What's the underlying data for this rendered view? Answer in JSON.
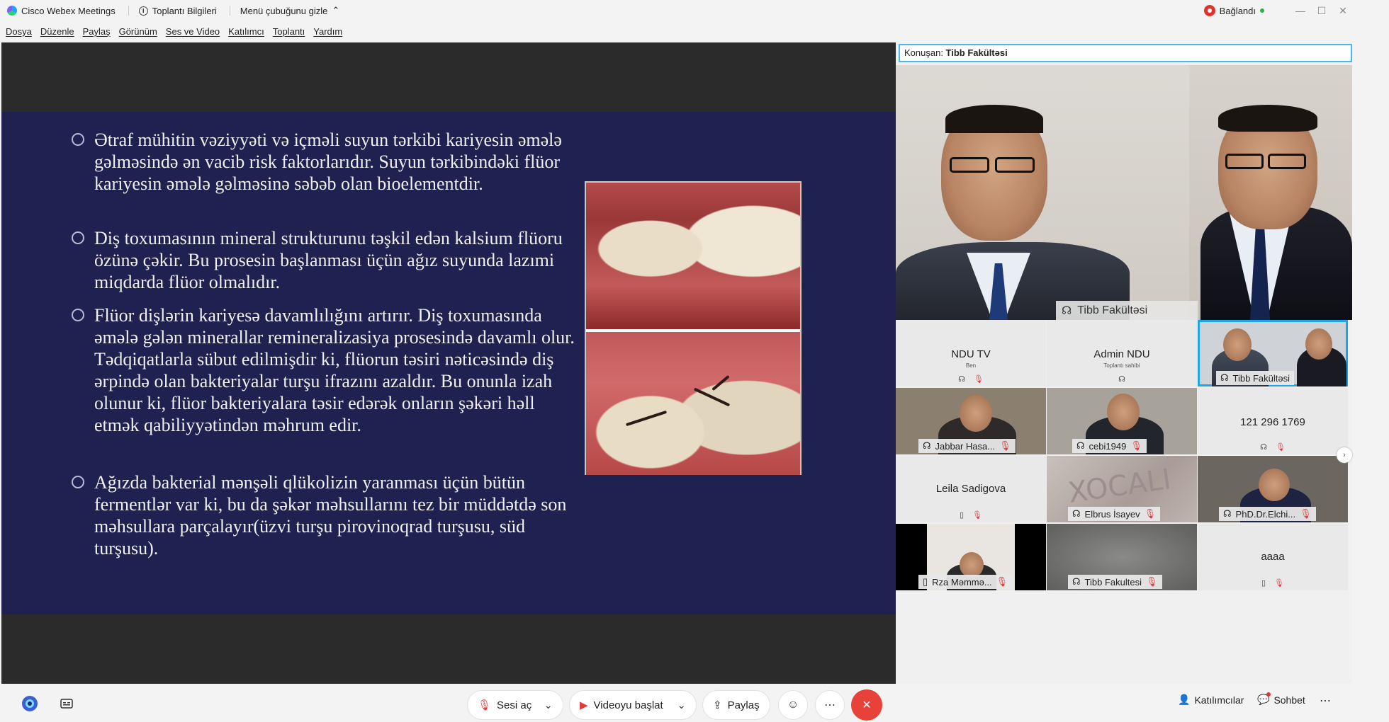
{
  "titlebar": {
    "app_name": "Cisco Webex Meetings",
    "meeting_info": "Toplantı Bilgileri",
    "hide_menu": "Menü çubuğunu gizle",
    "status": "Bağlandı"
  },
  "menu": [
    "Dosya",
    "Düzenle",
    "Paylaş",
    "Görünüm",
    "Ses ve Video",
    "Katılımcı",
    "Toplantı",
    "Yardım"
  ],
  "slide": {
    "bullets": [
      "Ətraf mühitin vəziyyəti və içməli suyun tərkibi  kariyesin əmələ gəlməsində  ən vacib risk faktorlarıdır. Suyun tərkibindəki flüor kariyesin əmələ gəlməsinə səbəb olan bioelementdir.",
      " Diş toxumasının mineral strukturunu təşkil edən kalsium flüoru özünə çəkir. Bu prosesin başlanması üçün ağız suyunda lazımi miqdarda flüor olmalıdır.",
      " Flüor dişlərin kariyesə davamlılığını artırır. Diş toxumasında əmələ gələn minerallar remineralizasiya prosesində davamlı olur. Tədqiqatlarla sübut edilmişdir ki, flüorun təsiri nəticəsində diş ərpində olan bakteriyalar turşu ifrazını azaldır. Bu onunla izah olunur ki, flüor bakteriyalara təsir edərək onların şəkəri həll etmək qabiliyyətindən məhrum edir.",
      "Ağızda bakterial mənşəli qlükolizin yaranması üçün bütün fermentlər var ki, bu da şəkər məhsullarını tez bir müddətdə son məhsullara parçalayır(üzvi  turşu pirovinoqrad turşusu, süd turşusu)."
    ]
  },
  "speaker": {
    "prefix": "Konuşan: ",
    "name": "Tibb Fakültəsi"
  },
  "main_video_label": "Tibb Fakültəsi",
  "participants": [
    {
      "name": "NDU TV",
      "sub": "Ben"
    },
    {
      "name": "Admin NDU",
      "sub": "Toplantı sahibi"
    },
    {
      "name": "Tibb Fakültəsi"
    },
    {
      "name": "Jabbar Hasa..."
    },
    {
      "name": "cebi1949"
    },
    {
      "name": "121 296 1769"
    },
    {
      "name": "Leila Sadigova"
    },
    {
      "name": "Elbrus İsayev"
    },
    {
      "name": "PhD.Dr.Elchi..."
    },
    {
      "name": "Rza Məmmə..."
    },
    {
      "name": "Tibb Fakultesi"
    },
    {
      "name": "aaaa"
    }
  ],
  "toolbar": {
    "unmute": "Sesi aç",
    "start_video": "Videoyu başlat",
    "share": "Paylaş",
    "participants": "Katılımcılar",
    "chat": "Sohbet"
  },
  "colors": {
    "slide_bg": "#1f2150",
    "accent": "#1ea4ea",
    "end": "#e8413a"
  }
}
